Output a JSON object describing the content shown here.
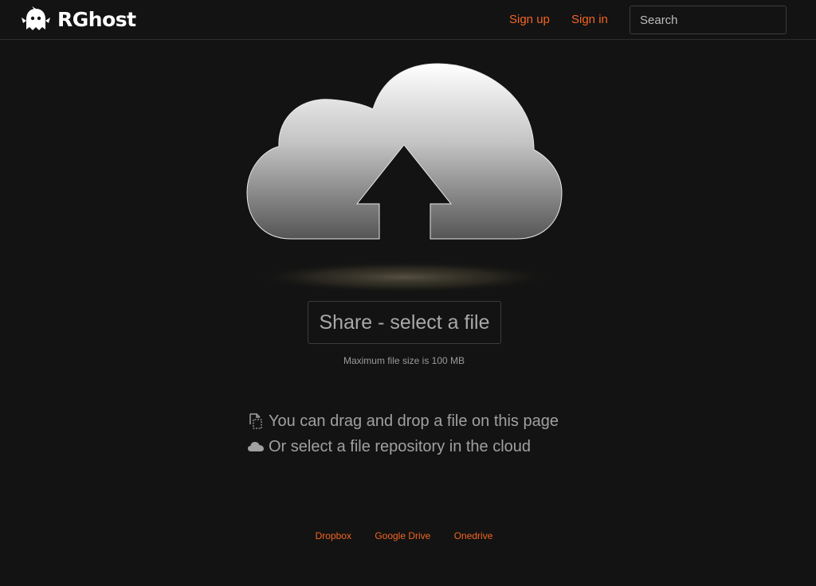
{
  "header": {
    "brand": "RGhost",
    "sign_up": "Sign up",
    "sign_in": "Sign in",
    "search_placeholder": "Search"
  },
  "main": {
    "upload_icon": "cloud-upload-icon",
    "share_button": "Share - select a file",
    "max_size": "Maximum file size is 100 MB",
    "hints": [
      {
        "icon": "drag-drop-icon",
        "text": "You can drag and drop a file on this page"
      },
      {
        "icon": "cloud-icon",
        "text": "Or select a file repository in the cloud"
      }
    ],
    "cloud_links": [
      "Dropbox",
      "Google Drive",
      "Onedrive"
    ]
  },
  "colors": {
    "background": "#131313",
    "accent": "#f26522",
    "text": "#9a9a9a"
  }
}
